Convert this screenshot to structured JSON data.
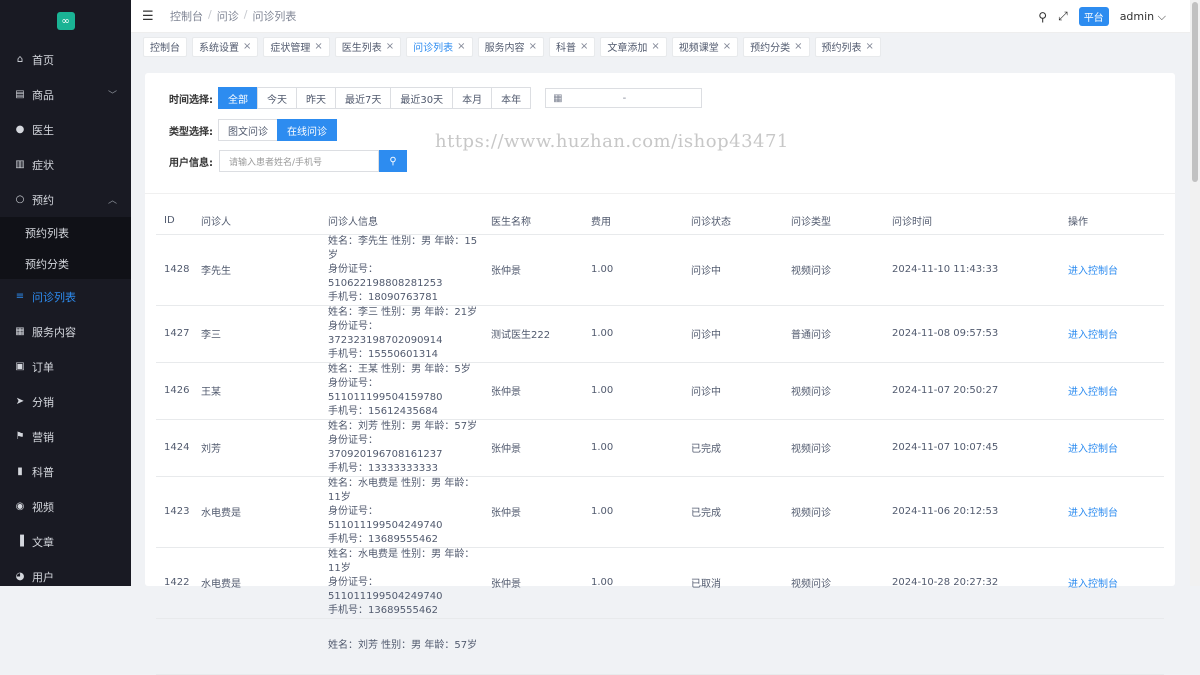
{
  "sidebar": {
    "items": [
      {
        "label": "首页",
        "icon": "home-icon",
        "glyph": "⌂"
      },
      {
        "label": "商品",
        "icon": "shop-icon",
        "glyph": "▤"
      },
      {
        "label": "医生",
        "icon": "user-icon",
        "glyph": "●"
      },
      {
        "label": "症状",
        "icon": "book-icon",
        "glyph": "▥"
      },
      {
        "label": "预约",
        "icon": "person-icon",
        "glyph": "○"
      }
    ],
    "sub_items": [
      {
        "label": "预约列表"
      },
      {
        "label": "预约分类"
      }
    ],
    "items2": [
      {
        "label": "问诊列表",
        "icon": "list-icon",
        "glyph": "≡"
      },
      {
        "label": "服务内容",
        "icon": "doc-icon",
        "glyph": "▦"
      },
      {
        "label": "订单",
        "icon": "order-icon",
        "glyph": "▣"
      },
      {
        "label": "分销",
        "icon": "send-icon",
        "glyph": "➤"
      },
      {
        "label": "营销",
        "icon": "flag-icon",
        "glyph": "⚑"
      },
      {
        "label": "科普",
        "icon": "barcode-icon",
        "glyph": "▮"
      },
      {
        "label": "视频",
        "icon": "camera-icon",
        "glyph": "◉"
      },
      {
        "label": "文章",
        "icon": "chart-icon",
        "glyph": "▐"
      },
      {
        "label": "用户",
        "icon": "users-icon",
        "glyph": "◕"
      }
    ]
  },
  "header": {
    "breadcrumb": [
      "控制台",
      "问诊",
      "问诊列表"
    ],
    "badge": "平台",
    "user": "admin ⌵"
  },
  "tabs": [
    {
      "label": "控制台",
      "closable": false
    },
    {
      "label": "系统设置",
      "closable": true
    },
    {
      "label": "症状管理",
      "closable": true
    },
    {
      "label": "医生列表",
      "closable": true
    },
    {
      "label": "问诊列表",
      "closable": true,
      "active": true
    },
    {
      "label": "服务内容",
      "closable": true
    },
    {
      "label": "科普",
      "closable": true
    },
    {
      "label": "文章添加",
      "closable": true
    },
    {
      "label": "视频课堂",
      "closable": true
    },
    {
      "label": "预约分类",
      "closable": true
    },
    {
      "label": "预约列表",
      "closable": true
    }
  ],
  "filters": {
    "time_label": "时间选择:",
    "time_options": [
      "全部",
      "今天",
      "昨天",
      "最近7天",
      "最近30天",
      "本月",
      "本年"
    ],
    "time_selected": 0,
    "date_dash": "-",
    "type_label": "类型选择:",
    "type_options": [
      "图文问诊",
      "在线问诊"
    ],
    "type_selected": 1,
    "user_label": "用户信息:",
    "user_placeholder": "请输入患者姓名/手机号"
  },
  "watermark": "https://www.huzhan.com/ishop43471",
  "table": {
    "columns": [
      "ID",
      "问诊人",
      "问诊人信息",
      "医生名称",
      "费用",
      "问诊状态",
      "问诊类型",
      "问诊时间",
      "操作"
    ],
    "rows": [
      {
        "id": "1428",
        "name": "李先生",
        "info1": "姓名：李先生 性别：男 年龄：15岁",
        "info2": "身份证号：510622198808281253",
        "info3": "手机号：18090763781",
        "doctor": "张仲景",
        "fee": "1.00",
        "status": "问诊中",
        "type": "视频问诊",
        "time": "2024-11-10 11:43:33",
        "action": "进入控制台"
      },
      {
        "id": "1427",
        "name": "李三",
        "info1": "姓名：李三 性别：男 年龄：21岁",
        "info2": "身份证号：372323198702090914",
        "info3": "手机号：15550601314",
        "doctor": "测试医生222",
        "fee": "1.00",
        "status": "问诊中",
        "type": "普通问诊",
        "time": "2024-11-08 09:57:53",
        "action": "进入控制台"
      },
      {
        "id": "1426",
        "name": "王某",
        "info1": "姓名：王某 性别：男 年龄：5岁",
        "info2": "身份证号：511011199504159780",
        "info3": "手机号：15612435684",
        "doctor": "张仲景",
        "fee": "1.00",
        "status": "问诊中",
        "type": "视频问诊",
        "time": "2024-11-07 20:50:27",
        "action": "进入控制台"
      },
      {
        "id": "1424",
        "name": "刘芳",
        "info1": "姓名：刘芳 性别：男 年龄：57岁",
        "info2": "身份证号：370920196708161237",
        "info3": "手机号：13333333333",
        "doctor": "张仲景",
        "fee": "1.00",
        "status": "已完成",
        "type": "视频问诊",
        "time": "2024-11-07 10:07:45",
        "action": "进入控制台"
      },
      {
        "id": "1423",
        "name": "水电费是",
        "info1": "姓名：水电费是 性别：男 年龄：11岁",
        "info2": "身份证号：511011199504249740",
        "info3": "手机号：13689555462",
        "doctor": "张仲景",
        "fee": "1.00",
        "status": "已完成",
        "type": "视频问诊",
        "time": "2024-11-06 20:12:53",
        "action": "进入控制台"
      },
      {
        "id": "1422",
        "name": "水电费是",
        "info1": "姓名：水电费是 性别：男 年龄：11岁",
        "info2": "身份证号：511011199504249740",
        "info3": "手机号：13689555462",
        "doctor": "张仲景",
        "fee": "1.00",
        "status": "已取消",
        "type": "视频问诊",
        "time": "2024-10-28 20:27:32",
        "action": "进入控制台"
      },
      {
        "id": "",
        "name": "",
        "info1": "姓名：刘芳 性别：男 年龄：57岁",
        "info2": "",
        "info3": "",
        "doctor": "",
        "fee": "",
        "status": "",
        "type": "",
        "time": "",
        "action": ""
      }
    ]
  }
}
